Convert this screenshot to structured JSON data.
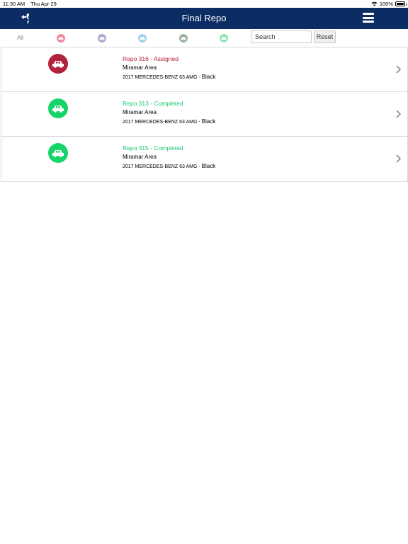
{
  "status_bar": {
    "time": "11:30 AM",
    "date": "Thu Apr 29",
    "battery": "100%"
  },
  "nav": {
    "title": "Final Repo"
  },
  "filters": {
    "all_label": "All",
    "dots": [
      {
        "color": "#f08aa0"
      },
      {
        "color": "#b3a8cf"
      },
      {
        "color": "#9fd4e8"
      },
      {
        "color": "#9ab39e"
      },
      {
        "color": "#8ee7b4"
      }
    ]
  },
  "search": {
    "placeholder": "Search",
    "reset_label": "Reset"
  },
  "items": [
    {
      "title": "Repo 316 - Assigned",
      "title_color": "#b3223d",
      "avatar_color": "#b3223d",
      "area": "Miramar Area",
      "vehicle": "2017 MERCEDES-BENZ 63 AMG - ",
      "color": "Black"
    },
    {
      "title": "Repo 313 - Completed",
      "title_color": "#17c770",
      "avatar_color": "#17d46a",
      "area": "Miramar Area",
      "vehicle": "2017 MERCEDES-BENZ 63 AMG - ",
      "color": "Black"
    },
    {
      "title": "Repo 315 - Completed",
      "title_color": "#17c770",
      "avatar_color": "#17d46a",
      "area": "Miramar Area",
      "vehicle": "2017 MERCEDES-BENZ 63 AMG - ",
      "color": "Black"
    }
  ]
}
